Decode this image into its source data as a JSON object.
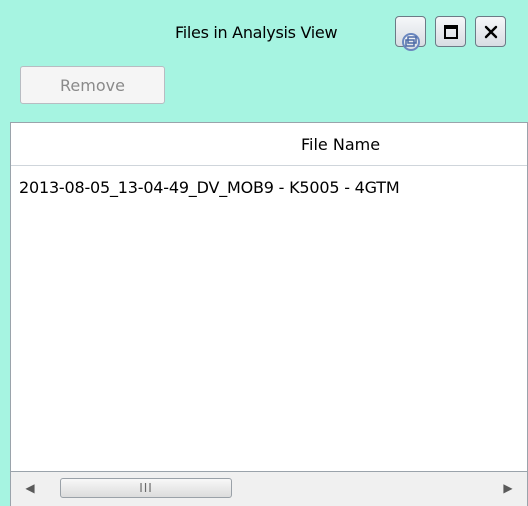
{
  "window": {
    "title": "Files in Analysis View",
    "buttons": [
      {
        "name": "restore",
        "icon": "restore-icon"
      },
      {
        "name": "maximize",
        "icon": "maximize-icon"
      },
      {
        "name": "close",
        "icon": "close-icon",
        "glyph": "✕"
      }
    ]
  },
  "toolbar": {
    "remove_label": "Remove"
  },
  "table": {
    "columns": [
      "File Name"
    ],
    "rows": [
      [
        "2013-08-05_13-04-49_DV_MOB9 - K5005 - 4GTM"
      ]
    ]
  },
  "scrollbar": {
    "left_glyph": "◀",
    "right_glyph": "▶",
    "thumb_glyph": "III"
  },
  "colors": {
    "panel_bg": "#a6f4e1",
    "table_bg": "#ffffff"
  }
}
